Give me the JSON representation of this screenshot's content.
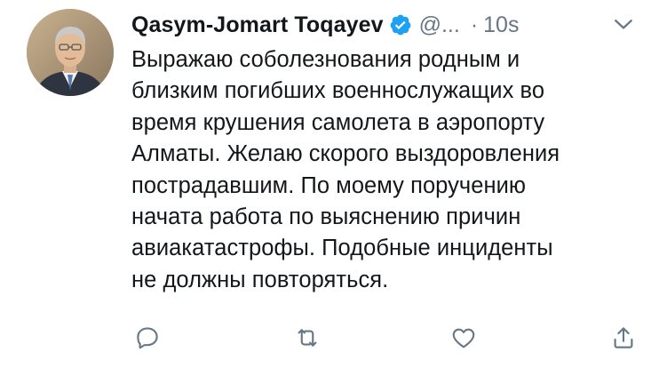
{
  "tweet": {
    "author": {
      "name": "Qasym-Jomart Toqayev",
      "handle": "@...",
      "verified": true
    },
    "separator": "·",
    "time": "10s",
    "text_lines": [
      "Выражаю соболезнования родным и",
      "близким погибших военнослужащих во",
      "время крушения самолета в аэропорту",
      "Алматы. Желаю скорого выздоровления",
      "пострадавшим. По моему поручению",
      "начата работа по выяснению причин",
      "авиакатастрофы. Подобные инциденты",
      "не должны повторяться."
    ],
    "actions": [
      "reply-icon",
      "retweet-icon",
      "like-icon",
      "share-icon"
    ]
  },
  "colors": {
    "text": "#14171a",
    "secondary": "#657786",
    "verified": "#1da1f2",
    "icon": "#657786"
  }
}
